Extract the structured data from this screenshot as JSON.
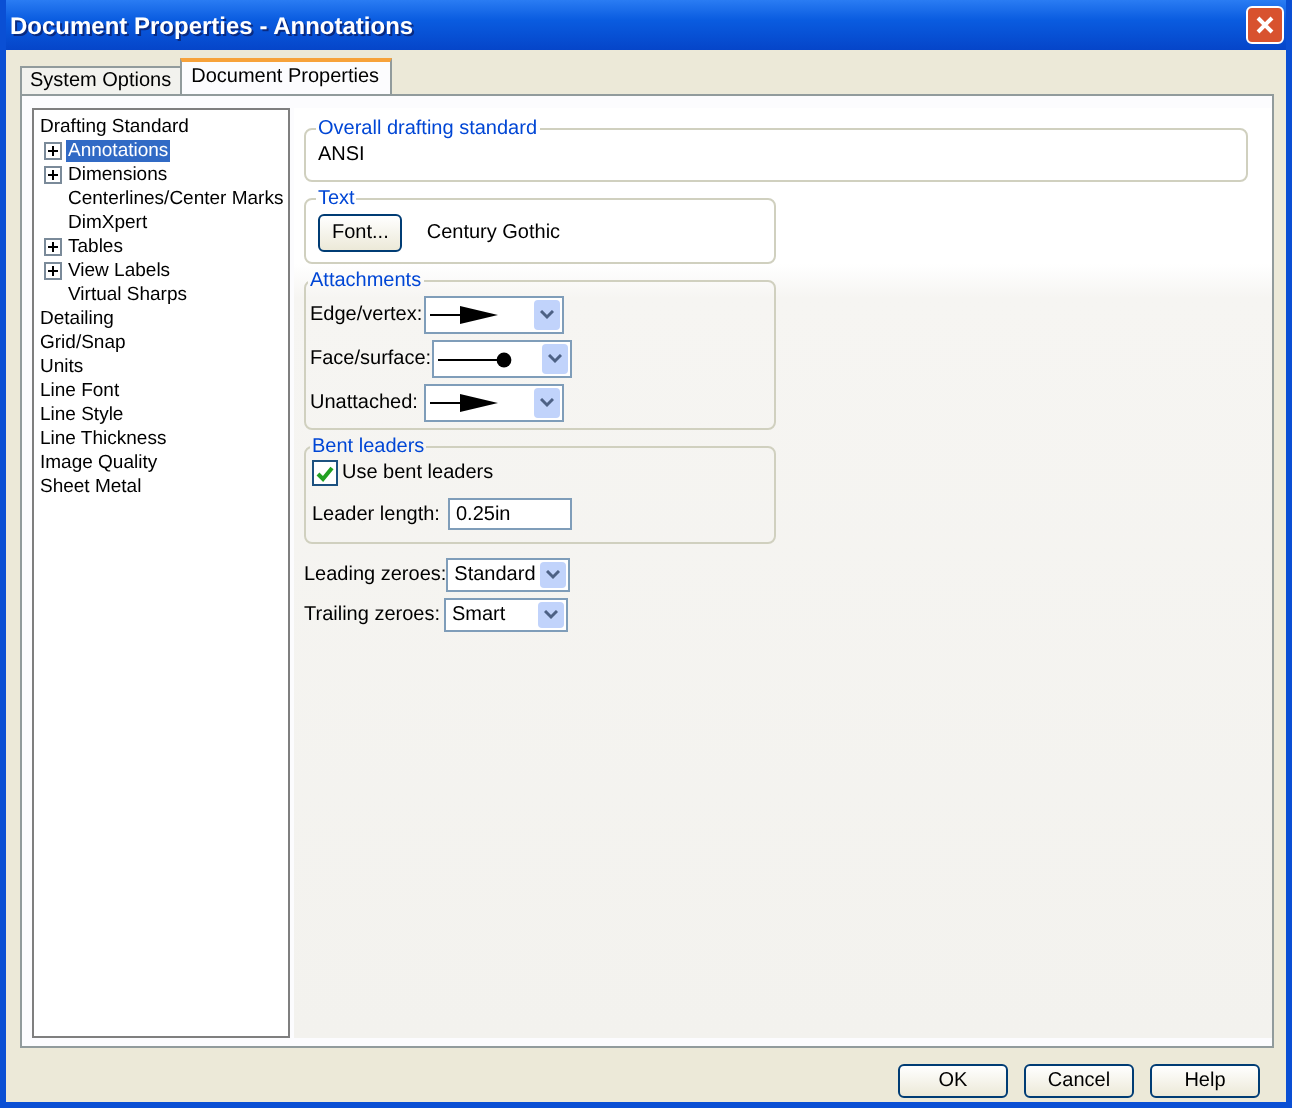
{
  "window": {
    "title": "Document Properties - Annotations"
  },
  "tabs": [
    {
      "label": "System Options",
      "selected": false
    },
    {
      "label": "Document Properties",
      "selected": true
    }
  ],
  "tree": [
    {
      "label": "Drafting Standard",
      "selected": false,
      "children": [
        {
          "label": "Annotations",
          "kind": "collapsed",
          "selected": true
        },
        {
          "label": "Dimensions",
          "kind": "collapsed",
          "selected": false
        },
        {
          "label": "Centerlines/Center Marks",
          "kind": "leaf",
          "selected": false
        },
        {
          "label": "DimXpert",
          "kind": "leaf",
          "selected": false
        },
        {
          "label": "Tables",
          "kind": "collapsed",
          "selected": false
        },
        {
          "label": "View Labels",
          "kind": "collapsed",
          "selected": false
        },
        {
          "label": "Virtual Sharps",
          "kind": "leaf",
          "selected": false
        }
      ]
    },
    {
      "label": "Detailing",
      "selected": false
    },
    {
      "label": "Grid/Snap",
      "selected": false
    },
    {
      "label": "Units",
      "selected": false
    },
    {
      "label": "Line Font",
      "selected": false
    },
    {
      "label": "Line Style",
      "selected": false
    },
    {
      "label": "Line Thickness",
      "selected": false
    },
    {
      "label": "Image Quality",
      "selected": false
    },
    {
      "label": "Sheet Metal",
      "selected": false
    }
  ],
  "overall_standard": {
    "title": "Overall drafting standard",
    "value": "ANSI"
  },
  "text": {
    "title": "Text",
    "button": "Font...",
    "font": "Century Gothic"
  },
  "attachments": {
    "title": "Attachments",
    "rows": [
      {
        "label": "Edge/vertex:",
        "kind": "arrow"
      },
      {
        "label": "Face/surface:",
        "kind": "dot"
      },
      {
        "label": "Unattached:",
        "kind": "arrow"
      }
    ]
  },
  "bent_leaders": {
    "title": "Bent leaders",
    "checkbox": {
      "label": "Use bent leaders",
      "checked": true
    },
    "length_label": "Leader length:",
    "length_value": "0.25in"
  },
  "zeroes": [
    {
      "label": "Leading zeroes:",
      "value": "Standard"
    },
    {
      "label": "Trailing zeroes:",
      "value": "Smart"
    }
  ],
  "buttons": [
    "OK",
    "Cancel",
    "Help"
  ]
}
